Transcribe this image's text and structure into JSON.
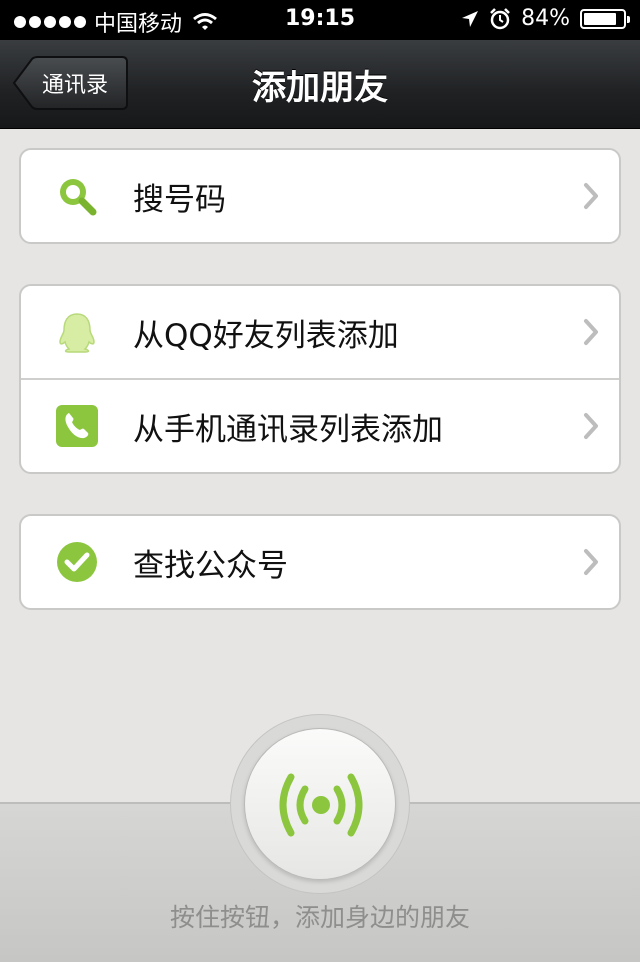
{
  "status_bar": {
    "carrier": "中国移动",
    "time": "19:15",
    "battery": "84%",
    "battery_level": 0.84
  },
  "nav": {
    "back_label": "通讯录",
    "title": "添加朋友"
  },
  "groups": [
    {
      "items": [
        {
          "label": "搜号码",
          "icon": "search-icon"
        }
      ]
    },
    {
      "items": [
        {
          "label": "从QQ好友列表添加",
          "icon": "qq-penguin-icon"
        },
        {
          "label": "从手机通讯录列表添加",
          "icon": "phone-icon"
        }
      ]
    },
    {
      "items": [
        {
          "label": "查找公众号",
          "icon": "checkmark-icon"
        }
      ]
    }
  ],
  "hint": "按住按钮，添加身边的朋友",
  "colors": {
    "accent_green": "#8cc63f",
    "nav_dark": "#1f2123",
    "background": "#e6e5e3"
  }
}
